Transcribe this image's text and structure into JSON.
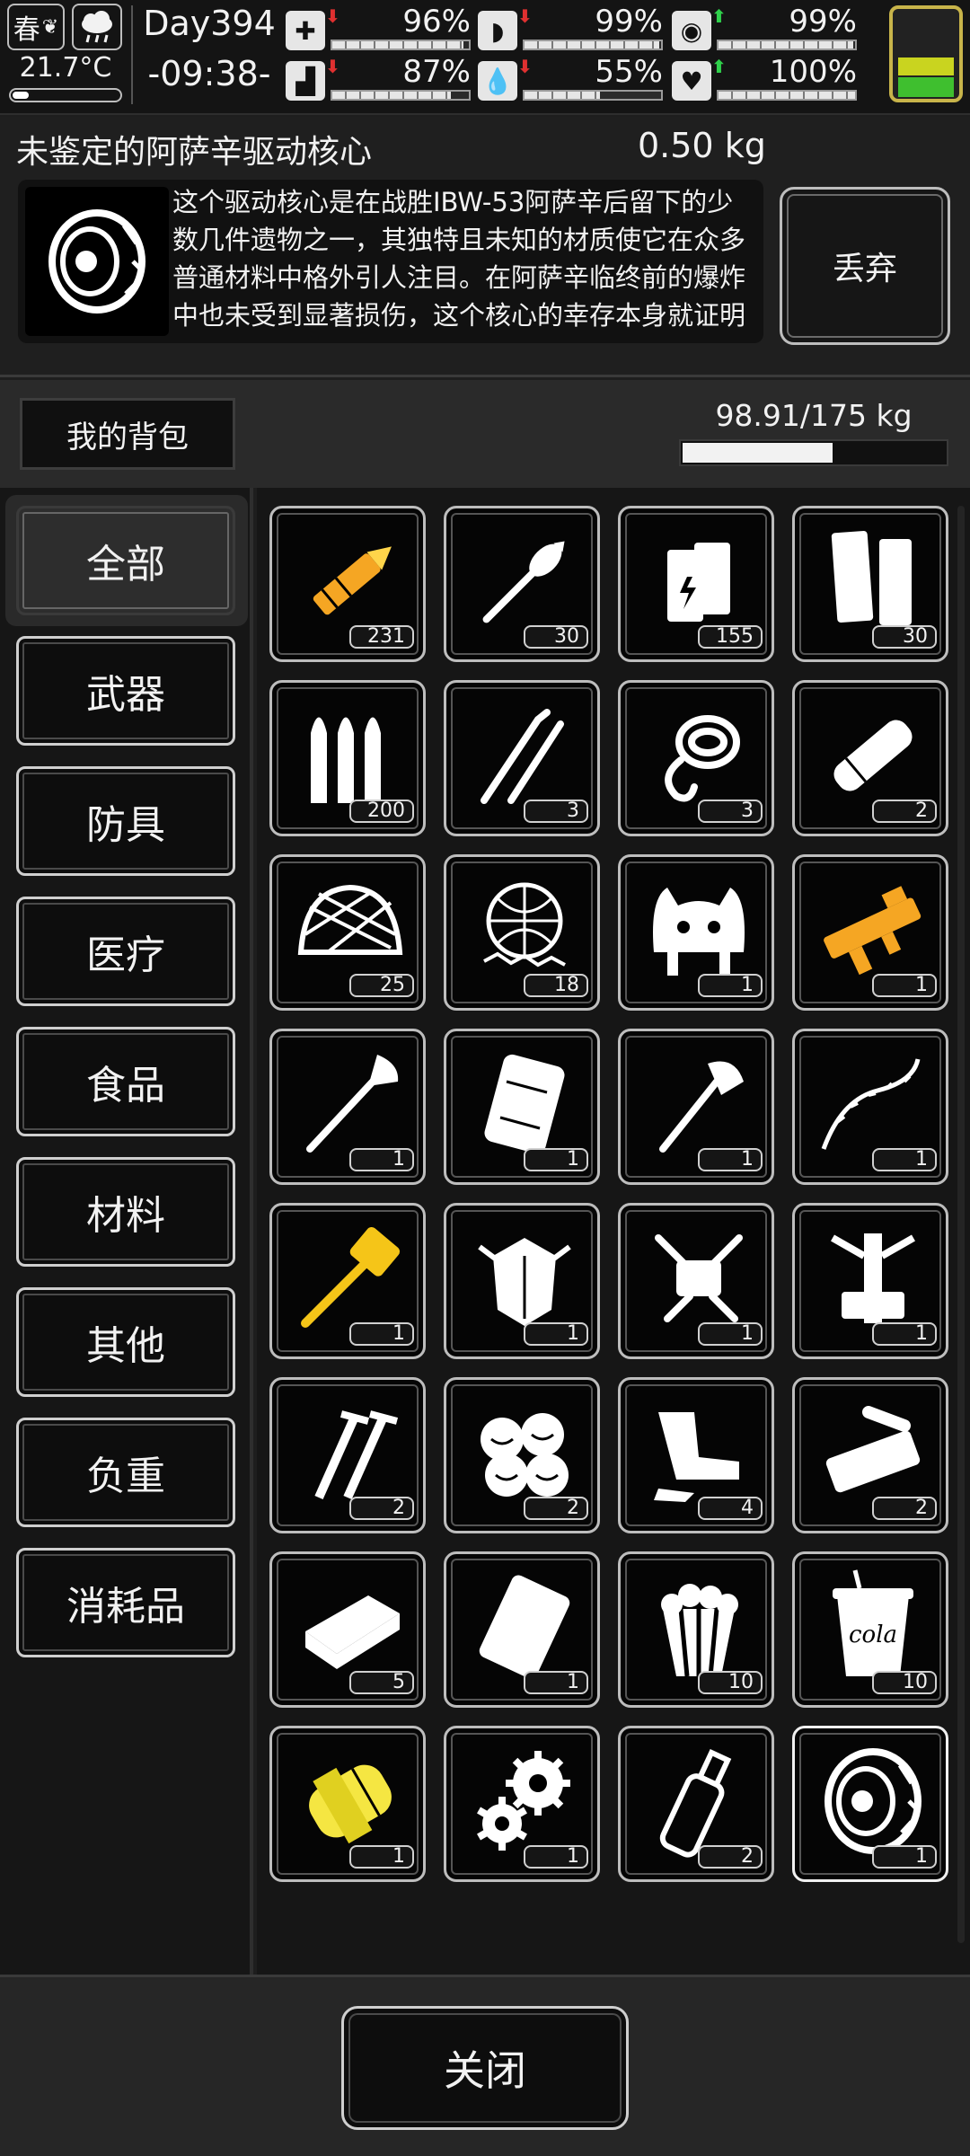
{
  "status": {
    "season": "春",
    "temperature": "21.7°C",
    "temperature_level": 0.1,
    "day": "Day394",
    "time": "-09:38-",
    "battery_level": 0.42,
    "stats": [
      {
        "name": "health",
        "icon": "medkit-icon",
        "value": "96%",
        "level": 0.96,
        "trend": "down"
      },
      {
        "name": "hunger",
        "icon": "stomach-icon",
        "value": "99%",
        "level": 0.99,
        "trend": "down"
      },
      {
        "name": "mood",
        "icon": "mask-icon",
        "value": "99%",
        "level": 0.99,
        "trend": "up"
      },
      {
        "name": "stamina",
        "icon": "boot-icon",
        "value": "87%",
        "level": 0.87,
        "trend": "down"
      },
      {
        "name": "thirst",
        "icon": "water-drop-icon",
        "value": "55%",
        "level": 0.55,
        "trend": "down"
      },
      {
        "name": "heart",
        "icon": "heart-icon",
        "value": "100%",
        "level": 1.0,
        "trend": "up"
      }
    ]
  },
  "item": {
    "title": "未鉴定的阿萨辛驱动核心",
    "weight": "0.50 kg",
    "icon": "tire-core-icon",
    "description": "这个驱动核心是在战胜IBW-53阿萨辛后留下的少数几件遗物之一，其独特且未知的材质使它在众多普通材料中格外引人注目。在阿萨辛临终前的爆炸中也未受到显著损伤，这个核心的幸存本身就证明了它的非凡价值和异常的耐久性。其复杂",
    "discard_label": "丢弃"
  },
  "bag": {
    "label": "我的背包",
    "weight_text": "98.91/175 kg",
    "load_fraction": 0.565
  },
  "categories": [
    {
      "label": "全部",
      "active": true
    },
    {
      "label": "武器",
      "active": false
    },
    {
      "label": "防具",
      "active": false
    },
    {
      "label": "医疗",
      "active": false
    },
    {
      "label": "食品",
      "active": false
    },
    {
      "label": "材料",
      "active": false
    },
    {
      "label": "其他",
      "active": false
    },
    {
      "label": "负重",
      "active": false
    },
    {
      "label": "消耗品",
      "active": false
    }
  ],
  "items": [
    {
      "icon": "rocket-ammo-icon",
      "count": "231",
      "color": "#f5a623"
    },
    {
      "icon": "rpg-warhead-icon",
      "count": "30",
      "color": "#ffffff"
    },
    {
      "icon": "battery-pack-icon",
      "count": "155",
      "color": "#ffffff"
    },
    {
      "icon": "paper-sheets-icon",
      "count": "30",
      "color": "#ffffff"
    },
    {
      "icon": "bullets-icon",
      "count": "200",
      "color": "#ffffff"
    },
    {
      "icon": "lockpick-icon",
      "count": "3",
      "color": "#ffffff"
    },
    {
      "icon": "rope-hook-icon",
      "count": "3",
      "color": "#ffffff"
    },
    {
      "icon": "bandage-roll-icon",
      "count": "2",
      "color": "#ffffff"
    },
    {
      "icon": "camo-helmet-icon",
      "count": "25",
      "color": "#ffffff"
    },
    {
      "icon": "camo-net-icon",
      "count": "18",
      "color": "#ffffff"
    },
    {
      "icon": "animal-hat-icon",
      "count": "1",
      "color": "#ffffff"
    },
    {
      "icon": "toy-gun-icon",
      "count": "1",
      "color": "#f5a623"
    },
    {
      "icon": "shovel-icon",
      "count": "1",
      "color": "#ffffff"
    },
    {
      "icon": "plate-armor-icon",
      "count": "1",
      "color": "#ffffff"
    },
    {
      "icon": "axe-icon",
      "count": "1",
      "color": "#ffffff"
    },
    {
      "icon": "barbed-whip-icon",
      "count": "1",
      "color": "#ffffff"
    },
    {
      "icon": "golden-hammer-icon",
      "count": "1",
      "color": "#f5c518"
    },
    {
      "icon": "exo-armor-icon",
      "count": "1",
      "color": "#ffffff"
    },
    {
      "icon": "drone-parts-icon",
      "count": "1",
      "color": "#ffffff"
    },
    {
      "icon": "mech-frame-icon",
      "count": "1",
      "color": "#ffffff"
    },
    {
      "icon": "screws-icon",
      "count": "2",
      "color": "#ffffff"
    },
    {
      "icon": "cotton-balls-icon",
      "count": "2",
      "color": "#ffffff"
    },
    {
      "icon": "metal-scraps-icon",
      "count": "4",
      "color": "#ffffff"
    },
    {
      "icon": "machine-parts-icon",
      "count": "2",
      "color": "#ffffff"
    },
    {
      "icon": "ration-bar-icon",
      "count": "5",
      "color": "#ffffff"
    },
    {
      "icon": "snack-bag-icon",
      "count": "1",
      "color": "#ffffff"
    },
    {
      "icon": "popcorn-icon",
      "count": "10",
      "color": "#ffffff"
    },
    {
      "icon": "cola-cup-icon",
      "count": "10",
      "color": "#ffffff",
      "text": "cola"
    },
    {
      "icon": "yellow-capsule-icon",
      "count": "1",
      "color": "#f5e642"
    },
    {
      "icon": "gears-icon",
      "count": "1",
      "color": "#ffffff"
    },
    {
      "icon": "bottle-icon",
      "count": "2",
      "color": "#ffffff"
    },
    {
      "icon": "tire-core-icon",
      "count": "1",
      "color": "#ffffff",
      "selected": true
    }
  ],
  "close_label": "关闭"
}
